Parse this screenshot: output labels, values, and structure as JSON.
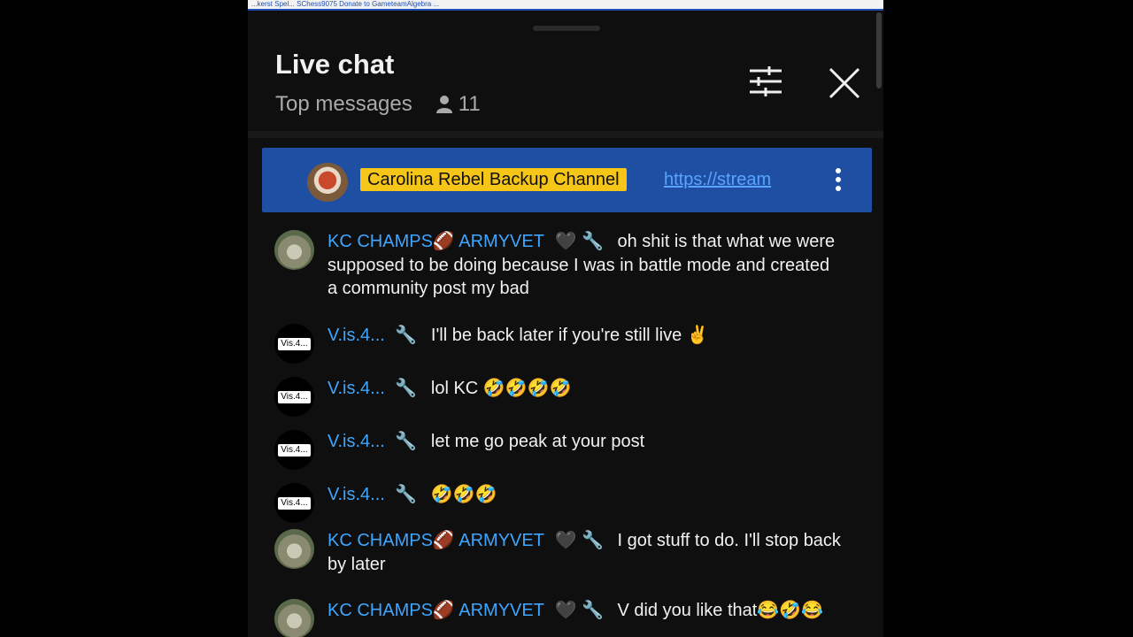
{
  "ticker": {
    "text": "...kerst Spel... SChess9075 Donate to GameteamAlgebra ..."
  },
  "header": {
    "title": "Live chat",
    "mode": "Top messages",
    "viewer_count": "11"
  },
  "pinned": {
    "channel": "Carolina Rebel Backup Channel",
    "link": "https://stream"
  },
  "messages": [
    {
      "author": "KC CHAMPS🏈 ARMYVET",
      "badges": "🖤 🔧",
      "text": "oh shit is that what we were supposed to be doing because I was in battle mode and created a community post my bad"
    },
    {
      "author": "V.is.4...",
      "badges": "🔧",
      "text": "I'll be back later if you're still live ✌"
    },
    {
      "author": "V.is.4...",
      "badges": "🔧",
      "text": "lol KC 🤣🤣🤣🤣"
    },
    {
      "author": "V.is.4...",
      "badges": "🔧",
      "text": "let me go peak at your post"
    },
    {
      "author": "V.is.4...",
      "badges": "🔧",
      "text": "🤣🤣🤣"
    },
    {
      "author": "KC CHAMPS🏈 ARMYVET",
      "badges": "🖤 🔧",
      "text": "I got stuff to do. I'll stop back by later"
    },
    {
      "author": "KC CHAMPS🏈 ARMYVET",
      "badges": "🖤 🔧",
      "text": "V did you like that😂🤣😂"
    }
  ],
  "avatars": {
    "v_label": "Vis.4..."
  },
  "colors": {
    "author": "#3ea6ff",
    "pinned_bg": "#1f4fa3",
    "badge": "#f5c518",
    "link": "#5aa4ff"
  },
  "icons": {
    "filter": "sliders-icon",
    "close": "close-icon",
    "viewer": "person-icon",
    "menu": "kebab-menu-icon"
  }
}
